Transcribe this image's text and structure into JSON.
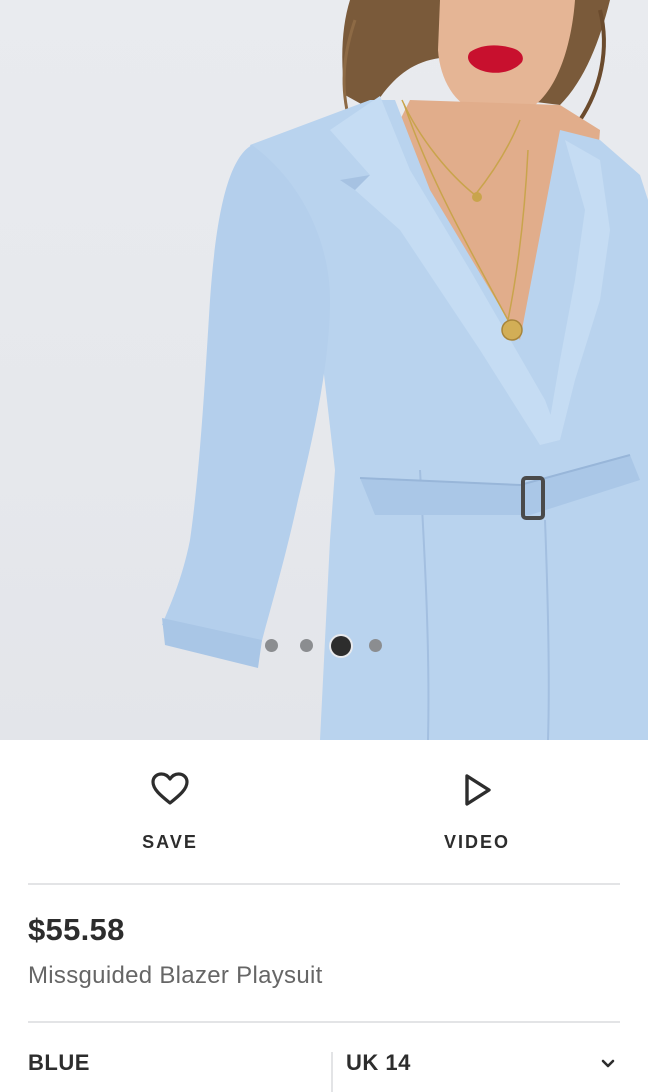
{
  "gallery": {
    "image_alt": "Model wearing a light blue blazer playsuit with belt",
    "dots": [
      {
        "active": false
      },
      {
        "active": false
      },
      {
        "active": true
      },
      {
        "active": false
      }
    ]
  },
  "actions": {
    "save_label": "SAVE",
    "save_icon": "heart-icon",
    "video_label": "VIDEO",
    "video_icon": "play-icon"
  },
  "product": {
    "price": "$55.58",
    "name": "Missguided Blazer Playsuit"
  },
  "selectors": {
    "colour": "BLUE",
    "size": "UK 14",
    "size_icon": "chevron-down-icon"
  },
  "colors": {
    "text": "#2d2d2d",
    "muted": "#666666",
    "fabric": "#b9d3ee",
    "divider": "#e3e4e6"
  }
}
